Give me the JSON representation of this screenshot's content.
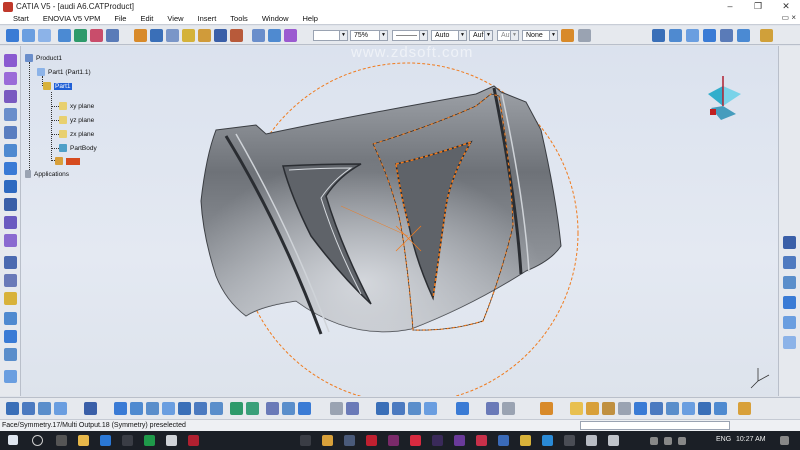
{
  "window": {
    "title": "CATIA V5 - [audi A6.CATProduct]",
    "controls": {
      "minimize": "–",
      "restore": "❐",
      "close": "✕"
    }
  },
  "menubar": {
    "items": [
      "Start",
      "ENOVIA V5 VPM",
      "File",
      "Edit",
      "View",
      "Insert",
      "Tools",
      "Window",
      "Help"
    ],
    "restore_glyph": "▭ ×"
  },
  "toolbar": {
    "line_width_value": "",
    "zoom_value": "75%",
    "line_type_value": "———",
    "color_value": "Auto",
    "layer_value": "Auf",
    "layer_value2": "Auf",
    "filter_value": "None"
  },
  "spec_tree": {
    "root": "Product1",
    "part_instance": "Part1 (Part1.1)",
    "part": "Part1",
    "planes": [
      "xy plane",
      "yz plane",
      "zx plane"
    ],
    "body": "PartBody",
    "geo_set_label": "",
    "applications": "Applications"
  },
  "watermark": "www.zdsoft.com",
  "status": {
    "message": "Face/Symmetry.17/Multi Output.18 (Symmetry) preselected"
  },
  "taskbar": {
    "language": "ENG",
    "time": "10:27 AM"
  },
  "icons": {
    "compass": "compass-icon",
    "axis": "axis-system-icon"
  },
  "colors": {
    "selection_orange": "#f07b1e",
    "tree_highlight": "#1f5fd6",
    "background": "#dfe3ea"
  }
}
